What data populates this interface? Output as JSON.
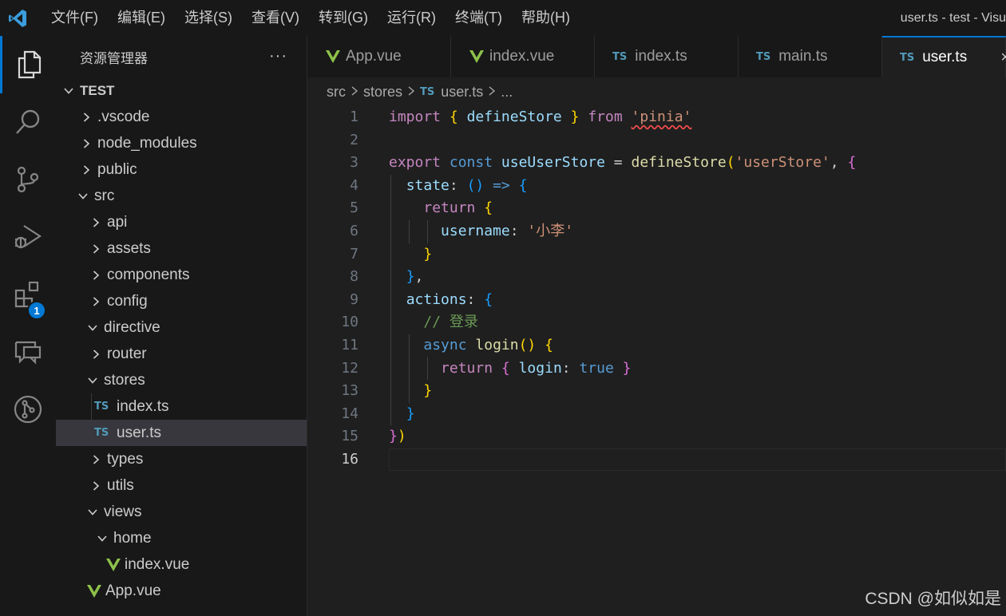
{
  "titlebar": {
    "menu": [
      "文件(F)",
      "编辑(E)",
      "选择(S)",
      "查看(V)",
      "转到(G)",
      "运行(R)",
      "终端(T)",
      "帮助(H)"
    ],
    "window_title": "user.ts - test - Visu"
  },
  "activitybar": {
    "items": [
      "explorer-icon",
      "search-icon",
      "source-control-icon",
      "run-debug-icon",
      "extensions-icon",
      "remote-explorer-icon",
      "git-graph-icon"
    ],
    "extensions_badge": "1"
  },
  "sidebar": {
    "title": "资源管理器",
    "more": "···",
    "root": "TEST",
    "tree": [
      {
        "label": ".vscode"
      },
      {
        "label": "node_modules"
      },
      {
        "label": "public"
      },
      {
        "label": "src"
      },
      {
        "label": "api"
      },
      {
        "label": "assets"
      },
      {
        "label": "components"
      },
      {
        "label": "config"
      },
      {
        "label": "directive"
      },
      {
        "label": "router"
      },
      {
        "label": "stores"
      },
      {
        "label": "index.ts"
      },
      {
        "label": "user.ts"
      },
      {
        "label": "types"
      },
      {
        "label": "utils"
      },
      {
        "label": "views"
      },
      {
        "label": "home"
      },
      {
        "label": "index.vue"
      },
      {
        "label": "App.vue"
      }
    ]
  },
  "tabs": [
    {
      "label": "App.vue"
    },
    {
      "label": "index.vue"
    },
    {
      "label": "index.ts"
    },
    {
      "label": "main.ts"
    },
    {
      "label": "user.ts"
    }
  ],
  "icons": {
    "ts": "TS",
    "close": "×"
  },
  "breadcrumb": {
    "parts": [
      "src",
      "stores",
      "user.ts",
      "..."
    ]
  },
  "editor": {
    "line_numbers": [
      "1",
      "2",
      "3",
      "4",
      "5",
      "6",
      "7",
      "8",
      "9",
      "10",
      "11",
      "12",
      "13",
      "14",
      "15",
      "16"
    ],
    "tokens": {
      "l1": [
        "import",
        "{",
        "defineStore",
        "}",
        "from",
        "'pinia'"
      ],
      "l3": [
        "export",
        "const",
        "useUserStore",
        "=",
        "defineStore",
        "(",
        "'userStore'",
        ",",
        "{"
      ],
      "l4": [
        "state",
        ":",
        "()",
        "=>",
        "{"
      ],
      "l5": [
        "return",
        "{"
      ],
      "l6": [
        "username",
        ":",
        "'小李'"
      ],
      "l7": [
        "}"
      ],
      "l8": [
        "}",
        ","
      ],
      "l9": [
        "actions",
        ":",
        "{"
      ],
      "l10": [
        "// 登录"
      ],
      "l11": [
        "async",
        "login",
        "()",
        "{"
      ],
      "l12": [
        "return",
        "{",
        "login",
        ":",
        "true",
        "}"
      ],
      "l13": [
        "}"
      ],
      "l14": [
        "}"
      ],
      "l15": [
        "}",
        ")"
      ]
    }
  },
  "watermark": "CSDN @如似如是"
}
